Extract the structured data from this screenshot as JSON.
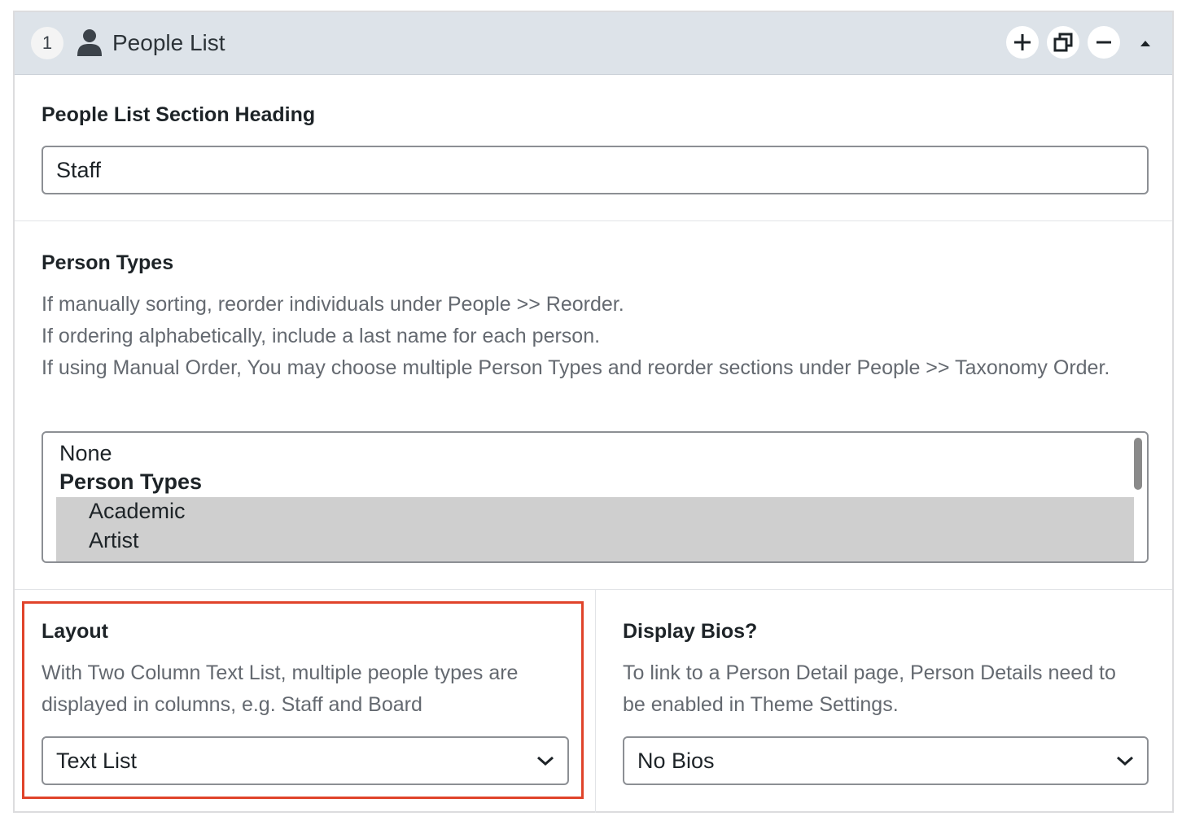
{
  "header": {
    "row_number": "1",
    "icon": "person-icon",
    "title": "People List",
    "actions": [
      "add-icon",
      "duplicate-icon",
      "remove-icon",
      "collapse-icon"
    ]
  },
  "heading_field": {
    "label": "People List Section Heading",
    "value": "Staff"
  },
  "person_types": {
    "label": "Person Types",
    "description": [
      "If manually sorting, reorder individuals under People >> Reorder.",
      "If ordering alphabetically, include a last name for each person.",
      "If using Manual Order, You may choose multiple Person Types and reorder sections under People >> Taxonomy Order."
    ],
    "options": {
      "none": "None",
      "group_label": "Person Types",
      "items": [
        "Academic",
        "Artist"
      ]
    }
  },
  "layout": {
    "label": "Layout",
    "description": "With Two Column Text List, multiple people types are displayed in columns, e.g. Staff and Board",
    "selected": "Text List"
  },
  "display_bios": {
    "label": "Display Bios?",
    "description": "To link to a Person Detail page, Person Details need to be enabled in Theme Settings.",
    "selected": "No Bios"
  },
  "colors": {
    "header_bg": "#dde3e9",
    "highlight_border": "#e0432a",
    "description_text": "#646970",
    "selected_option_bg": "#cfcfcf"
  }
}
